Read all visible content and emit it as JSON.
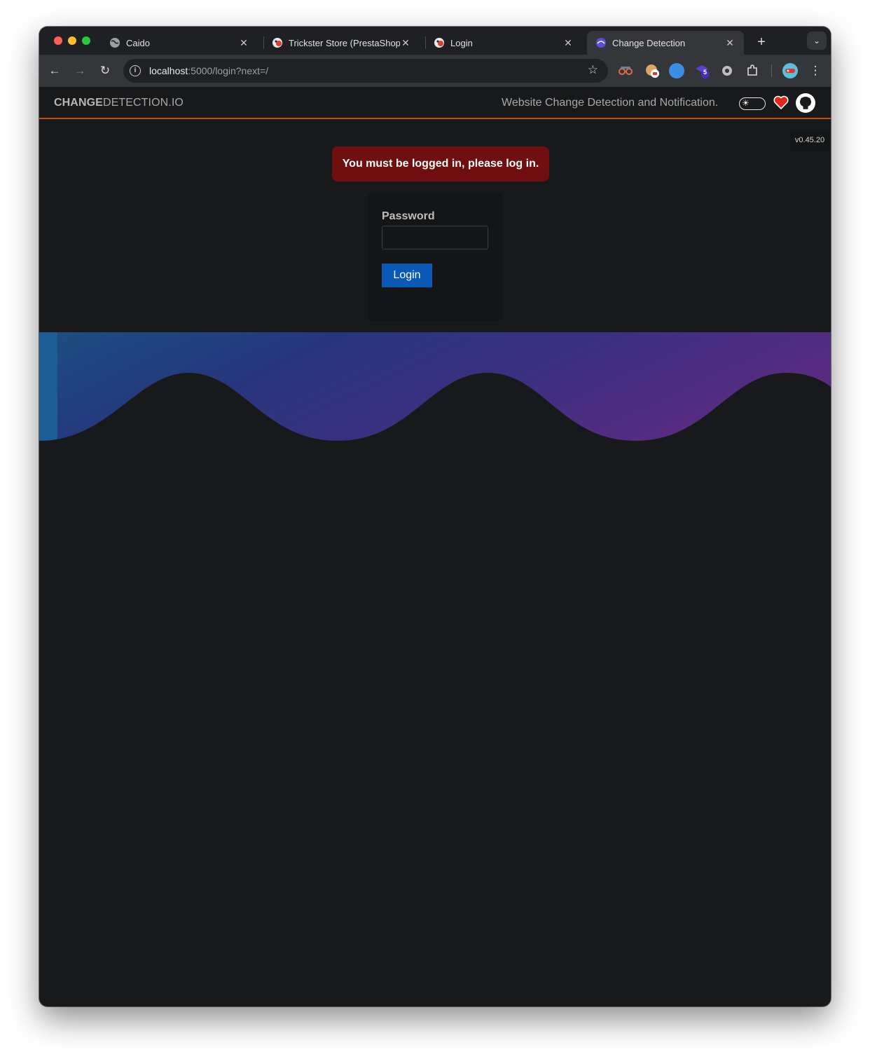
{
  "browser": {
    "tabs": [
      {
        "title": "Caido",
        "active": false
      },
      {
        "title": "Trickster Store (PrestaShop™)",
        "active": false
      },
      {
        "title": "Login",
        "active": false
      },
      {
        "title": "Change Detection",
        "active": true
      }
    ],
    "url_host": "localhost",
    "url_rest": ":5000/login?next=/",
    "extension_badge": "5"
  },
  "app": {
    "brand_bold": "CHANGE",
    "brand_rest": "DETECTION.IO",
    "tagline": "Website Change Detection and Notification.",
    "version": "v0.45.20",
    "flash_message": "You must be logged in, please log in.",
    "password_label": "Password",
    "password_value": "",
    "login_button": "Login"
  },
  "colors": {
    "accent_border": "#c54d0f",
    "flash_bg": "#6f0f0f",
    "button_bg": "#0b59b6",
    "page_bg": "#18191b"
  }
}
